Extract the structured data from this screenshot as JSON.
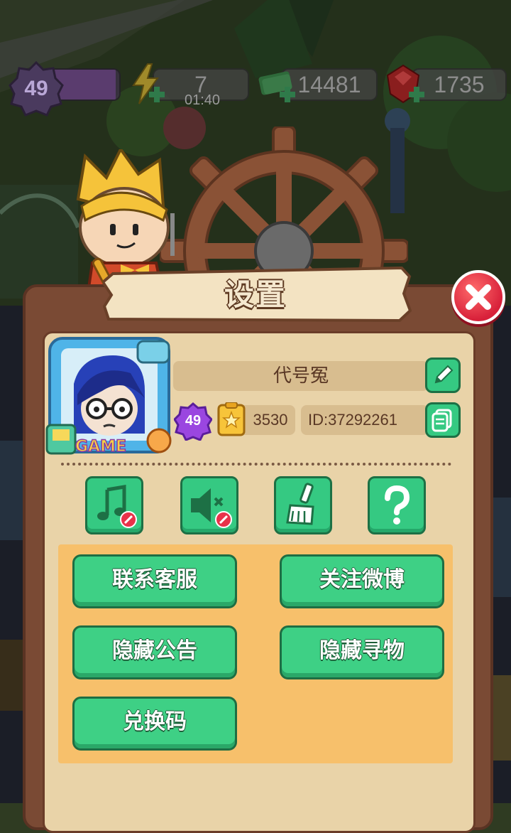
{
  "hud": {
    "level": "49",
    "xp_progress": 0.95,
    "energy": "7",
    "energy_timer": "01:40",
    "cash": "14481",
    "gems": "1735"
  },
  "panel": {
    "title": "设置"
  },
  "profile": {
    "name": "代号冤",
    "level": "49",
    "coins": "3530",
    "id": "ID:37292261",
    "avatar_badge": "GAME"
  },
  "icon_buttons": {
    "music": "music-off-icon",
    "sound": "sound-off-icon",
    "clean": "brush-icon",
    "help": "question-icon"
  },
  "actions": {
    "contact": "联系客服",
    "weibo": "关注微博",
    "hide_notice": "隐藏公告",
    "hide_search": "隐藏寻物",
    "redeem": "兑换码"
  },
  "colors": {
    "panel_brown": "#7a4a34",
    "panel_cream": "#e9d3a8",
    "button_green": "#3ed085",
    "action_bg": "#f7c06b",
    "close_red": "#d8213a"
  }
}
